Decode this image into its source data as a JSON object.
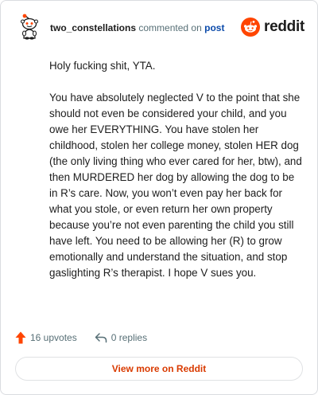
{
  "header": {
    "username": "two_constellations",
    "commented_on": "commented on",
    "post_link": "post",
    "brand_name": "reddit"
  },
  "comment": {
    "paragraphs": [
      "Holy fucking shit, YTA.",
      "You have absolutely neglected V to the point that she should not even be considered your child, and you owe her EVERYTHING. You have stolen her childhood, stolen her college money, stolen HER dog (the only living thing who ever cared for her, btw), and then MURDERED her dog by allowing the dog to be in R’s care. Now, you won’t even pay her back for what you stole, or even return her own property because you’re not even parenting the child you still have left. You need to be allowing her (R) to grow emotionally and understand the situation, and stop gaslighting R’s therapist. I hope V sues you."
    ]
  },
  "actions": {
    "upvotes": "16 upvotes",
    "replies": "0 replies"
  },
  "footer": {
    "view_more": "View more on Reddit"
  },
  "colors": {
    "brand_orange": "#ff4500",
    "link_blue": "#0b4aaa",
    "view_more_text": "#d93a00",
    "muted_text": "#576f76"
  },
  "icons": {
    "avatar": "snoo-avatar-icon",
    "brand": "reddit-logo-icon",
    "upvote": "upvote-arrow-icon",
    "reply": "reply-arrow-icon"
  }
}
